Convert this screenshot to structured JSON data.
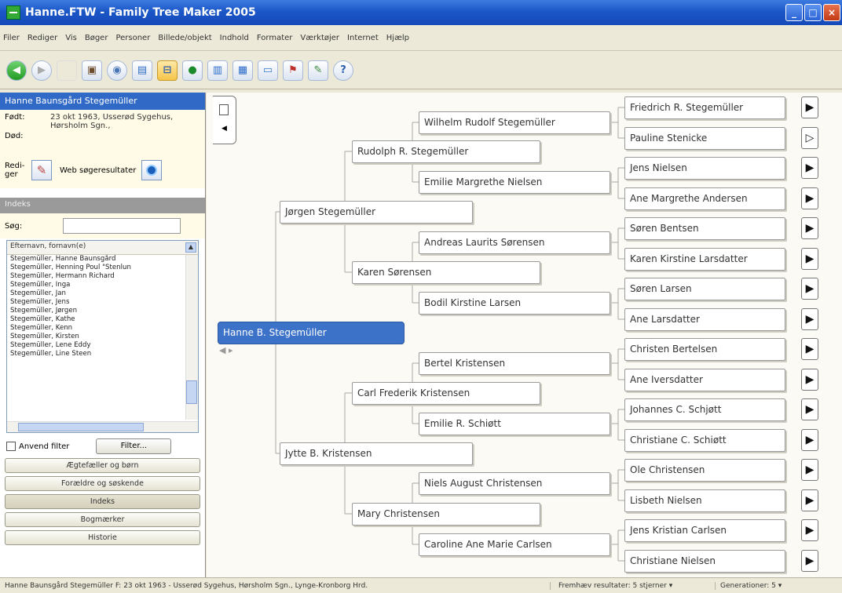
{
  "window": {
    "title": "Hanne.FTW - Family Tree Maker 2005"
  },
  "menu": [
    "Filer",
    "Rediger",
    "Vis",
    "Bøger",
    "Personer",
    "Billede/objekt",
    "Indhold",
    "Formater",
    "Værktøjer",
    "Internet",
    "Hjælp"
  ],
  "toolbar": {
    "icons": [
      "back-icon",
      "forward-icon",
      "blank-icon",
      "image-icon",
      "globe-icon",
      "family-view-icon",
      "pedigree-view-icon",
      "search-web-icon",
      "report-icon",
      "book-icon",
      "folder-icon",
      "flag-icon",
      "tools-icon",
      "help-icon"
    ]
  },
  "person": {
    "name": "Hanne Baunsgård Stegemüller",
    "born_label": "Født:",
    "born_value": "23 okt 1963, Usserød Sygehus, Hørsholm Sgn.,",
    "died_label": "Død:",
    "died_value": "",
    "edit_label": "Redi-ger",
    "web_label": "Web søgeresultater"
  },
  "index": {
    "header": "Indeks",
    "search_label": "Søg:",
    "search_value": "",
    "column_header": "Efternavn, fornavn(e)",
    "names": [
      "Stegemüller, Hanne Baunsgård",
      "Stegemüller, Henning Poul \"Stenlun",
      "Stegemüller, Hermann Richard",
      "Stegemüller, Inga",
      "Stegemüller, Jan",
      "Stegemüller, Jens",
      "Stegemüller, Jørgen",
      "Stegemüller, Kathe",
      "Stegemüller, Kenn",
      "Stegemüller, Kirsten",
      "Stegemüller, Lene Eddy",
      "Stegemüller, Line Steen"
    ],
    "use_filter_label": "Anvend filter",
    "filter_button": "Filter..."
  },
  "nav_buttons": [
    "Ægtefæller og børn",
    "Forældre og søskende",
    "Indeks",
    "Bogmærker",
    "Historie"
  ],
  "tree": {
    "root": "Hanne B. Stegemüller",
    "parents": [
      "Jørgen Stegemüller",
      "Jytte B. Kristensen"
    ],
    "grandparents": [
      "Rudolph R. Stegemüller",
      "Karen Sørensen",
      "Carl Frederik Kristensen",
      "Mary Christensen"
    ],
    "great_grandparents": [
      "Wilhelm Rudolf Stegemüller",
      "Emilie Margrethe Nielsen",
      "Andreas Laurits Sørensen",
      "Bodil Kirstine Larsen",
      "Bertel Kristensen",
      "Emilie R. Schiøtt",
      "Niels August Christensen",
      "Caroline Ane Marie Carlsen"
    ],
    "gg_grandparents": [
      "Friedrich R. Stegemüller",
      "Pauline Stenicke",
      "Jens Nielsen",
      "Ane Margrethe Andersen",
      "Søren Bentsen",
      "Karen Kirstine Larsdatter",
      "Søren Larsen",
      "Ane Larsdatter",
      "Christen Bertelsen",
      "Ane Iversdatter",
      "Johannes C. Schjøtt",
      "Christiane C. Schiøtt",
      "Ole Christensen",
      "Lisbeth Nielsen",
      "Jens Kristian Carlsen",
      "Christiane Nielsen"
    ]
  },
  "status": {
    "person_summary": "Hanne Baunsgård Stegemüller F: 23 okt 1963 - Usserød Sygehus, Hørsholm Sgn., Lynge-Kronborg Hrd.",
    "results": "Fremhæv resultater: 5 stjerner ▾",
    "generations": "Generationer: 5 ▾"
  }
}
